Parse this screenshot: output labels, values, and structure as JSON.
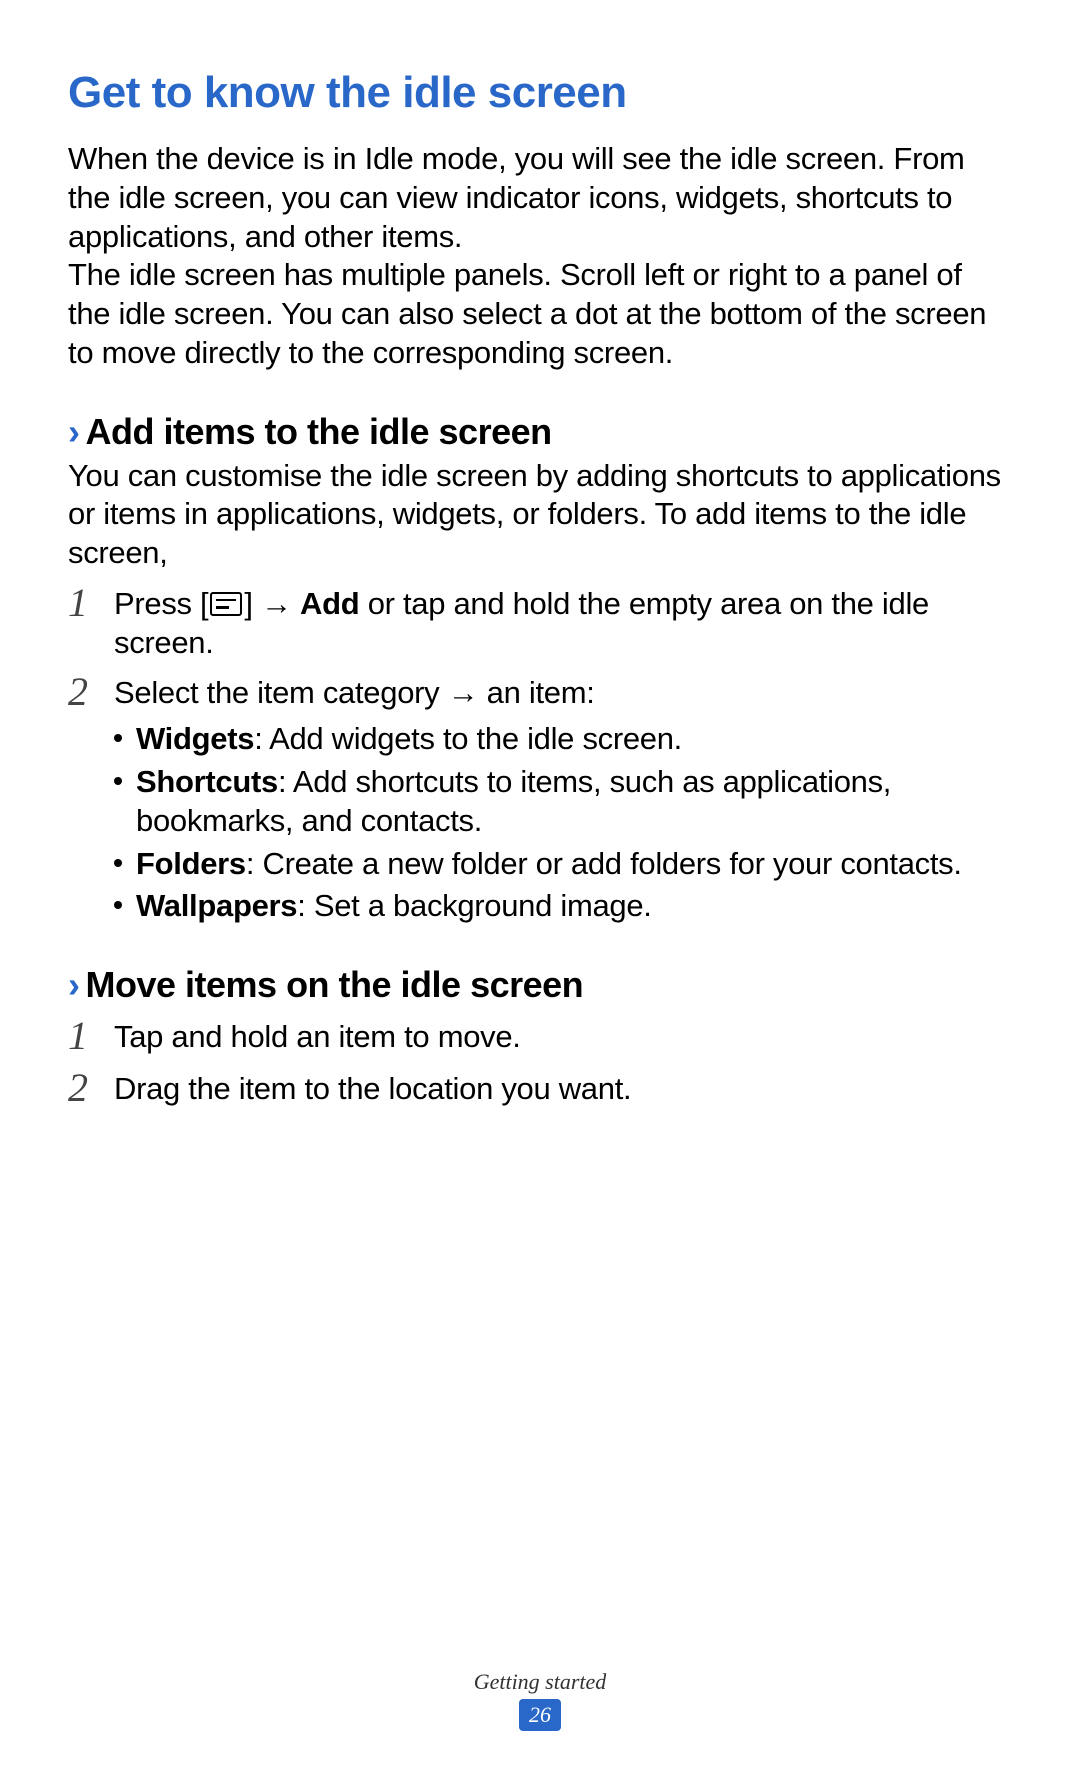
{
  "heading": "Get to know the idle screen",
  "intro_p1": "When the device is in Idle mode, you will see the idle screen. From the idle screen, you can view indicator icons, widgets, shortcuts to applications, and other items.",
  "intro_p2": "The idle screen has multiple panels. Scroll left or right to a panel of the idle screen. You can also select a dot at the bottom of the screen to move directly to the corresponding screen.",
  "section1": {
    "title": "Add items to the idle screen",
    "intro": "You can customise the idle screen by adding shortcuts to applications or items in applications, widgets, or folders. To add items to the idle screen,",
    "step1_num": "1",
    "step1_prefix": "Press [",
    "step1_mid": "] → ",
    "step1_bold": "Add",
    "step1_suffix": " or tap and hold the empty area on the idle screen.",
    "step2_num": "2",
    "step2_text": "Select the item category → an item:",
    "bullets": {
      "b1_label": "Widgets",
      "b1_text": ": Add widgets to the idle screen.",
      "b2_label": "Shortcuts",
      "b2_text": ": Add shortcuts to items, such as applications, bookmarks, and contacts.",
      "b3_label": "Folders",
      "b3_text": ": Create a new folder or add folders for your contacts.",
      "b4_label": "Wallpapers",
      "b4_text": ": Set a background image."
    }
  },
  "section2": {
    "title": "Move items on the idle screen",
    "step1_num": "1",
    "step1_text": "Tap and hold an item to move.",
    "step2_num": "2",
    "step2_text": "Drag the item to the location you want."
  },
  "footer": {
    "label": "Getting started",
    "page": "26"
  }
}
